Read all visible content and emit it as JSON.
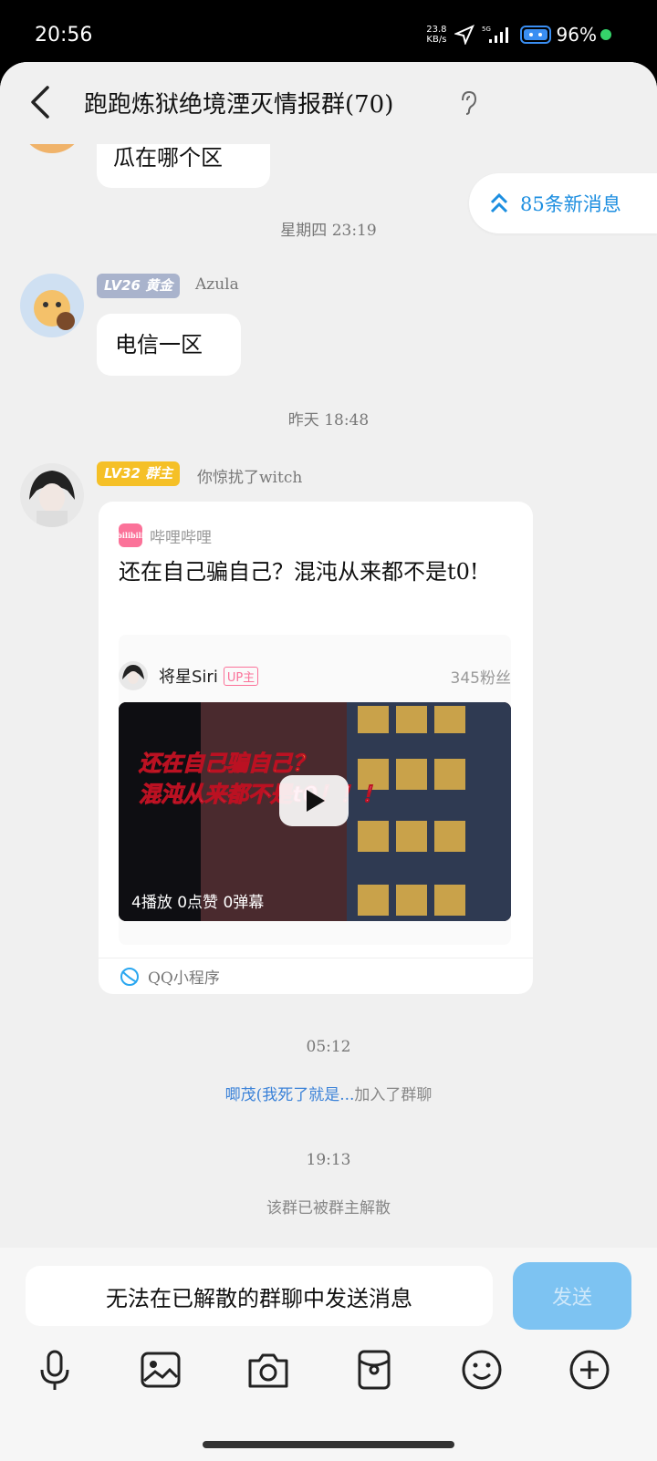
{
  "status_bar": {
    "time": "20:56",
    "net_speed_value": "23.8",
    "net_speed_unit": "KB/s",
    "network": "5G",
    "battery": "96%"
  },
  "header": {
    "title": "跑跑炼狱绝境湮灭情报群(70)"
  },
  "new_messages": "85条新消息",
  "messages": [
    {
      "text": "瓜在哪个区"
    },
    {
      "time": "星期四 23:19"
    },
    {
      "level": "LV26",
      "title": "黄金",
      "sender": "Azula",
      "text": "电信一区"
    },
    {
      "time": "昨天 18:48"
    },
    {
      "level": "LV32",
      "title": "群主",
      "sender": "你惊扰了witch",
      "card": {
        "source": "哔哩哔哩",
        "logo_text": "bilibili",
        "title": "还在自己骗自己？混沌从来都不是t0!",
        "up_name": "将星Siri",
        "up_tag": "UP主",
        "fans": "345粉丝",
        "video_caption_1": "还在自己骗自己？",
        "video_caption_2": "混沌从来都不是t0！！！",
        "video_stats": "4播放  0点赞  0弹幕",
        "footer": "QQ小程序"
      }
    },
    {
      "time": "05:12"
    },
    {
      "system_link": "唧茂(我死了就是...",
      "system_text": "加入了群聊"
    },
    {
      "time": "19:13"
    },
    {
      "system_text": "该群已被群主解散"
    }
  ],
  "input": {
    "placeholder": "无法在已解散的群聊中发送消息",
    "send_label": "发送"
  },
  "toolbar_icons": [
    "microphone-icon",
    "image-icon",
    "camera-icon",
    "red-packet-icon",
    "emoji-icon",
    "plus-icon"
  ],
  "colors": {
    "accent": "#1c8ee0",
    "badge_gold": "#a9b3cc",
    "badge_owner": "#f5c027",
    "send_disabled": "#7dc3f2",
    "bilibili": "#fb7299"
  }
}
